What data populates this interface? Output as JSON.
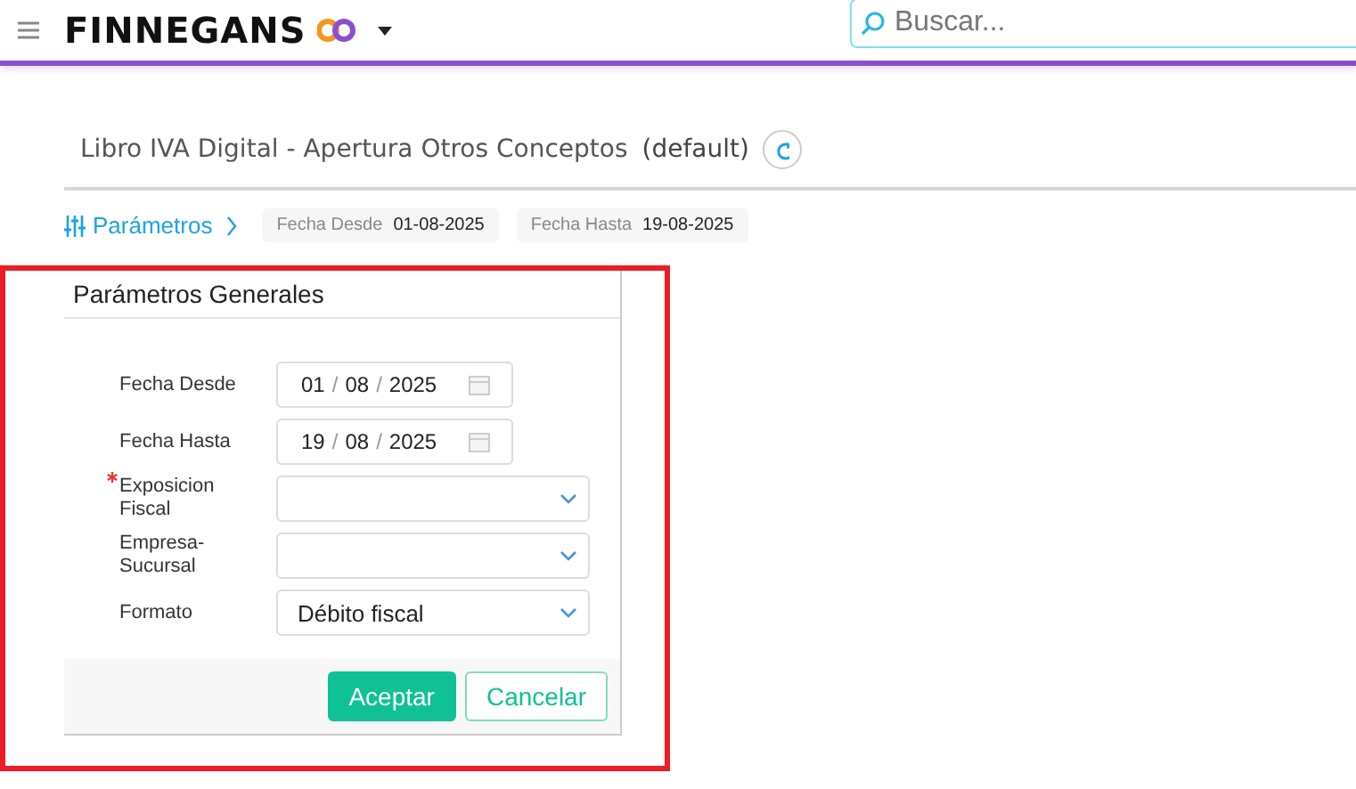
{
  "header": {
    "brand": "FINNEGANS",
    "search": {
      "placeholder": "Buscar..."
    }
  },
  "page": {
    "title": "Libro IVA Digital - Apertura Otros Conceptos",
    "view": "(default)"
  },
  "parameters_bar": {
    "label": "Parámetros",
    "expanded": true,
    "chips": [
      {
        "label": "Fecha Desde",
        "value": "01-08-2025"
      },
      {
        "label": "Fecha Hasta",
        "value": "19-08-2025"
      }
    ]
  },
  "dialog": {
    "title": "Parámetros Generales",
    "fields": [
      {
        "kind": "date",
        "label": "Fecha Desde",
        "required": false,
        "day": "01",
        "separator": "/",
        "month": "08",
        "year": "2025"
      },
      {
        "kind": "date",
        "label": "Fecha Hasta",
        "required": false,
        "day": "19",
        "separator": "/",
        "month": "08",
        "year": "2025"
      },
      {
        "kind": "select",
        "label": "Exposicion Fiscal",
        "required": true
      },
      {
        "kind": "select",
        "label": "Empresa-Sucursal",
        "required": false
      },
      {
        "kind": "select",
        "label": "Formato",
        "required": false,
        "value": "Débito fiscal"
      }
    ],
    "buttons": [
      {
        "kind": "primary",
        "label": "Aceptar"
      },
      {
        "kind": "secondary",
        "label": "Cancelar"
      }
    ]
  }
}
